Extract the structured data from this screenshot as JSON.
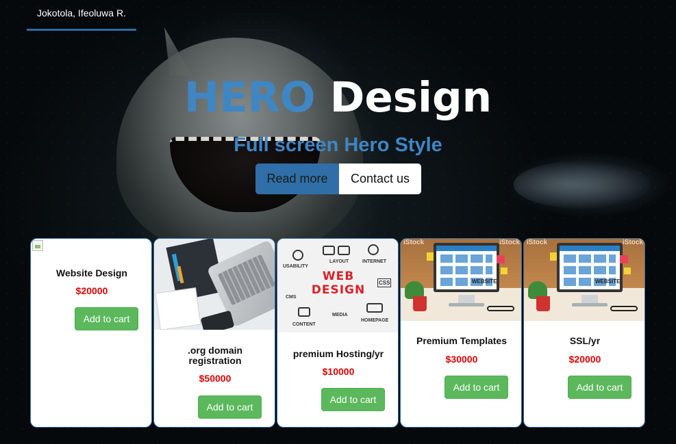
{
  "nav": {
    "brand": "Jokotola, Ifeoluwa R."
  },
  "hero": {
    "title_accent": "HERO",
    "title_rest": " Design",
    "subtitle": "Full screen Hero Style",
    "read_more_label": "Read more",
    "contact_label": "Contact us"
  },
  "colors": {
    "accent": "#3f86c4",
    "price": "#e00000",
    "add_button": "#5cb85c",
    "card_border": "#2e6da4"
  },
  "products": [
    {
      "name": "Website Design",
      "price": "$20000",
      "button": "Add to cart",
      "image": "broken-image-icon"
    },
    {
      "name": ".org domain registration",
      "price": "$50000",
      "button": "Add to cart",
      "image": "laptop-desk-photo"
    },
    {
      "name": "premium Hosting/yr",
      "price": "$10000",
      "button": "Add to cart",
      "image": "web-design-doodle-photo"
    },
    {
      "name": "Premium Templates",
      "price": "$30000",
      "button": "Add to cart",
      "image": "website-monitor-photo"
    },
    {
      "name": "SSL/yr",
      "price": "$20000",
      "button": "Add to cart",
      "image": "website-monitor-photo"
    }
  ],
  "image_text": {
    "web_design": "WEB\nDESIGN",
    "usability": "USABILITY",
    "layout": "LAYOUT",
    "internet": "INTERNET",
    "css": "CSS",
    "cms": "CMS",
    "content": "CONTENT",
    "media": "MEDIA",
    "homepage": "HOMEPAGE",
    "website": "WEBSITE",
    "watermark": "iStock"
  }
}
